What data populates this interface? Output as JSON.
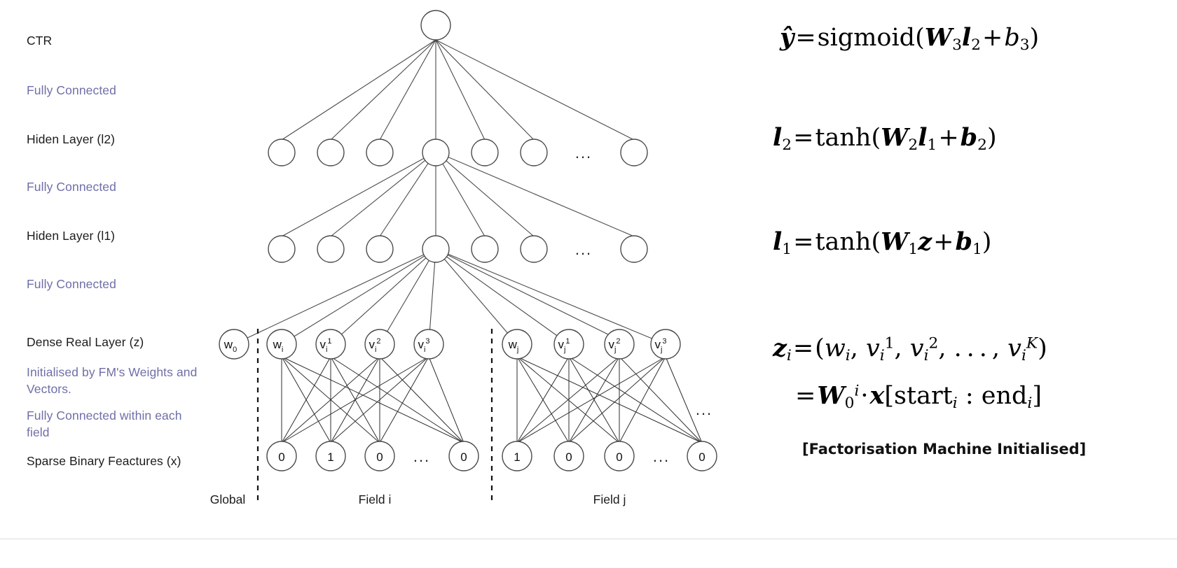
{
  "figure": {
    "title": "Deep CTR neural network with factorisation-machine-initialised dense real layer",
    "accent_note_color": "#6f6fa8",
    "text_color": "#1c1c1c",
    "node_stroke": "#4a4a4a"
  },
  "row_labels": [
    {
      "id": "ctr",
      "text": "CTR",
      "kind": "layer"
    },
    {
      "id": "fc-3",
      "text": "Fully Connected",
      "kind": "note"
    },
    {
      "id": "hidden-2",
      "text": "Hiden Layer (l2)",
      "kind": "layer"
    },
    {
      "id": "fc-2",
      "text": "Fully Connected",
      "kind": "note"
    },
    {
      "id": "hidden-1",
      "text": "Hiden Layer (l1)",
      "kind": "layer"
    },
    {
      "id": "fc-1",
      "text": "Fully Connected",
      "kind": "note"
    },
    {
      "id": "dense-real",
      "text": "Dense Real Layer (z)",
      "kind": "layer"
    },
    {
      "id": "init-fm",
      "text": "Initialised by FM's Weights and Vectors.",
      "kind": "note"
    },
    {
      "id": "fc-within",
      "text": "Fully Connected within each field",
      "kind": "note"
    },
    {
      "id": "sparse-binary",
      "text": "Sparse Binary Feactures (x)",
      "kind": "layer"
    }
  ],
  "layers": {
    "output": {
      "count": 1,
      "label": "CTR output unit"
    },
    "hidden2": {
      "count": 7,
      "ellipsis_after": 5,
      "label": "Hiden Layer (l2)"
    },
    "hidden1": {
      "count": 7,
      "ellipsis_after": 5,
      "label": "Hiden Layer (l1)"
    },
    "dense": {
      "global": [
        {
          "base": "w",
          "sub": "0",
          "sup": ""
        }
      ],
      "field_i": [
        {
          "base": "w",
          "sub": "i",
          "sup": ""
        },
        {
          "base": "v",
          "sub": "i",
          "sup": "1"
        },
        {
          "base": "v",
          "sub": "i",
          "sup": "2"
        },
        {
          "base": "v",
          "sub": "i",
          "sup": "3"
        }
      ],
      "field_j": [
        {
          "base": "w",
          "sub": "j",
          "sup": ""
        },
        {
          "base": "v",
          "sub": "j",
          "sup": "1"
        },
        {
          "base": "v",
          "sub": "j",
          "sup": "2"
        },
        {
          "base": "v",
          "sub": "j",
          "sup": "3"
        }
      ],
      "trailing_ellipsis": "..."
    },
    "sparse": {
      "field_i": [
        "0",
        "1",
        "0",
        "...",
        "0"
      ],
      "field_j": [
        "1",
        "0",
        "0",
        "...",
        "0"
      ]
    }
  },
  "field_labels": [
    {
      "id": "global",
      "text": "Global"
    },
    {
      "id": "field-i",
      "text": "Field i"
    },
    {
      "id": "field-j",
      "text": "Field j"
    }
  ],
  "equations": [
    {
      "id": "eq-output",
      "plain": "y-hat = sigmoid(W3 l2 + b3)",
      "lhs": "ŷ",
      "rhs": "sigmoid(W3l2 + b3)"
    },
    {
      "id": "eq-l2",
      "plain": "l2 = tanh(W2 l1 + b2)",
      "lhs": "l2",
      "rhs": "tanh(W2l1 + b2)"
    },
    {
      "id": "eq-l1",
      "plain": "l1 = tanh(W1 z + b1)",
      "lhs": "l1",
      "rhs": "tanh(W1z + b1)"
    },
    {
      "id": "eq-z-1",
      "plain": "z_i = (w_i, v_i^1, v_i^2, ..., v_i^K)",
      "lhs": "zi",
      "rhs": "(wi, vi1, vi2, ..., viK)"
    },
    {
      "id": "eq-z-2",
      "plain": "= W0^i · x[start_i : end_i]",
      "lhs": "",
      "rhs": "W0i · x[starti : endi]"
    }
  ],
  "fm_caption": "[Factorisation Machine Initialised]"
}
